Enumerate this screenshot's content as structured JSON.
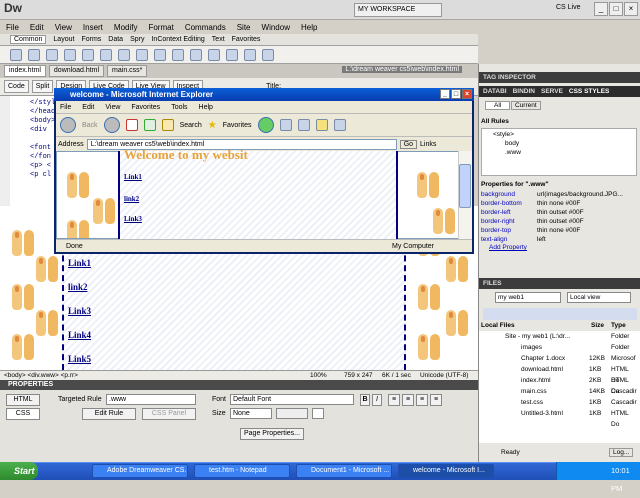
{
  "app": {
    "logo": "Dw",
    "workspace": "MY WORKSPACE",
    "cs_live": "CS Live"
  },
  "menu": [
    "File",
    "Edit",
    "View",
    "Insert",
    "Modify",
    "Format",
    "Commands",
    "Site",
    "Window",
    "Help"
  ],
  "insert_tabs": [
    "Common",
    "Layout",
    "Forms",
    "Data",
    "Spry",
    "InContext Editing",
    "Text",
    "Favorites"
  ],
  "doc_tabs": [
    "index.html",
    "download.html",
    "main.css*"
  ],
  "doc_path": "L:\\dream weaver cs5\\web\\index.html",
  "doc_buttons": [
    "Code",
    "Split",
    "Design",
    "Live Code",
    "Live View",
    "Inspect"
  ],
  "doc_title_label": "Title:",
  "code_lines": [
    "</style>",
    "</head>",
    "<body>",
    "<div",
    "",
    "<font",
    "</fon",
    "<p> <",
    "<p cl"
  ],
  "design": {
    "links": [
      "Link1",
      "link2",
      "Link3",
      "Link4",
      "Link5"
    ]
  },
  "status": {
    "tags": "<body> <div.www> <p.rr>",
    "zoom": "100%",
    "size": "759 x 247",
    "weight": "6K / 1 sec",
    "encoding": "Unicode (UTF-8)"
  },
  "properties": {
    "title": "PROPERTIES",
    "html_btn": "HTML",
    "css_btn": "CSS",
    "targeted_rule_label": "Targeted Rule",
    "targeted_rule_value": ".www",
    "edit_rule": "Edit Rule",
    "css_panel": "CSS Panel",
    "font_label": "Font",
    "font_value": "Default Font",
    "size_label": "Size",
    "size_value": "None",
    "page_props": "Page Properties..."
  },
  "ie": {
    "title": "welcome - Microsoft Internet Explorer",
    "menu": [
      "File",
      "Edit",
      "View",
      "Favorites",
      "Tools",
      "Help"
    ],
    "back": "Back",
    "search": "Search",
    "favorites": "Favorites",
    "address_label": "Address",
    "url": "L:\\dream weaver cs5\\web\\index.html",
    "go": "Go",
    "links": "Links",
    "heading": "Welcome to my websit",
    "links_list": [
      "Link1",
      "link2",
      "Link3"
    ],
    "status_left": "Done",
    "status_right": "My Computer"
  },
  "panel": {
    "tag_inspector": "TAG INSPECTOR",
    "tabs_top": [
      "DATABI",
      "BINDIN",
      "SERVE",
      "CSS STYLES"
    ],
    "all_tab": "All",
    "current_tab": "Current",
    "all_rules": "All Rules",
    "rules": [
      "<style>",
      "body",
      ".www"
    ],
    "props_for": "Properties for \".www\"",
    "props": [
      {
        "k": "background",
        "v": "url(images/background.JPG..."
      },
      {
        "k": "border-bottom",
        "v": "thin none #00F"
      },
      {
        "k": "border-left",
        "v": "thin outset #00F"
      },
      {
        "k": "border-right",
        "v": "thin outset #00F"
      },
      {
        "k": "border-top",
        "v": "thin none #00F"
      },
      {
        "k": "text-align",
        "v": "left"
      }
    ],
    "add_property": "Add Property",
    "files_head": "FILES",
    "site": "my web1",
    "view": "Local view",
    "local_files": "Local Files",
    "size_col": "Size",
    "type_col": "Type",
    "files": [
      {
        "name": "Site - my web1 (L:\\dr...",
        "size": "",
        "type": "Folder"
      },
      {
        "name": "images",
        "size": "",
        "type": "Folder"
      },
      {
        "name": "Chapter 1.docx",
        "size": "12KB",
        "type": "Microsof"
      },
      {
        "name": "download.html",
        "size": "1KB",
        "type": "HTML Do"
      },
      {
        "name": "index.html",
        "size": "2KB",
        "type": "HTML Do"
      },
      {
        "name": "main.css",
        "size": "14KB",
        "type": "Cascadir"
      },
      {
        "name": "test.css",
        "size": "1KB",
        "type": "Cascadir"
      },
      {
        "name": "Untitled-3.html",
        "size": "1KB",
        "type": "HTML Do"
      }
    ],
    "ready": "Ready",
    "log": "Log..."
  },
  "taskbar": {
    "start": "Start",
    "tasks": [
      "Adobe Dreamweaver CS...",
      "test.htm - Notepad",
      "Document1 - Microsoft ...",
      "welcome - Microsoft I..."
    ],
    "time": "10:01 PM"
  }
}
